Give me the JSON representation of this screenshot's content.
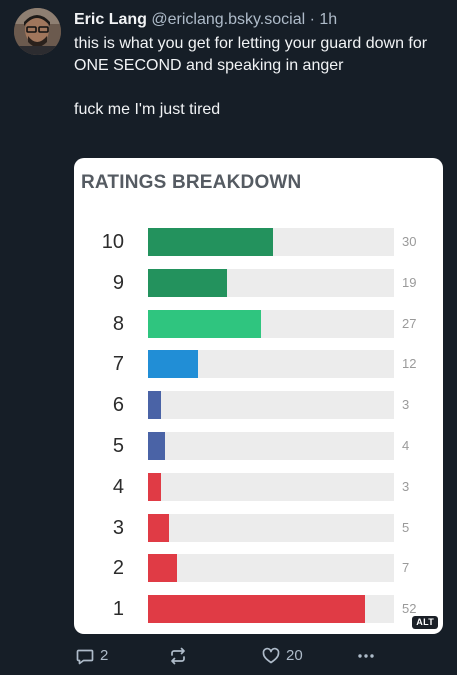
{
  "post": {
    "author_name": "Eric Lang",
    "handle": "@ericlang.bsky.social",
    "separator": "·",
    "time": "1h",
    "paragraphs": [
      "this is what you get for letting your guard down for ONE SECOND and speaking in anger",
      "fuck me I'm just tired"
    ]
  },
  "image": {
    "alt_badge": "ALT"
  },
  "chart_data": {
    "type": "bar",
    "orientation": "horizontal",
    "title": "RATINGS BREAKDOWN",
    "categories": [
      "10",
      "9",
      "8",
      "7",
      "6",
      "5",
      "4",
      "3",
      "2",
      "1"
    ],
    "values": [
      30,
      19,
      27,
      12,
      3,
      4,
      3,
      5,
      7,
      52
    ],
    "value_labels": [
      "30",
      "19",
      "27",
      "12",
      "3",
      "4",
      "3",
      "5",
      "7",
      "52"
    ],
    "xlim": [
      0,
      59
    ],
    "grid": false,
    "legend": "none",
    "colors": [
      "#23925d",
      "#23925d",
      "#2fc57f",
      "#218ed6",
      "#4a63a6",
      "#4a63a6",
      "#e03b45",
      "#e03b45",
      "#e03b45",
      "#e03b45"
    ],
    "track_color": "#ececec"
  },
  "actions": {
    "reply_icon": "speech-bubble-icon",
    "reply_count": "2",
    "repost_icon": "repost-arrows-icon",
    "like_icon": "heart-icon",
    "like_count": "20",
    "more_icon": "ellipsis-icon"
  }
}
